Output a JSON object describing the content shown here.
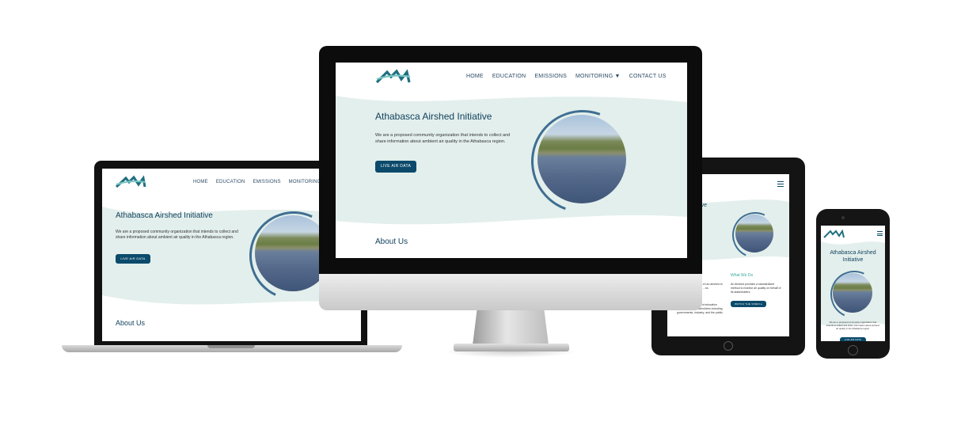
{
  "site": {
    "title": "Athabasca Airshed Initiative",
    "intro": "We are a proposed community organization that intends to collect and share information about ambient air quality in the Athabasca region.",
    "cta": "LIVE AIR DATA",
    "about": "About Us",
    "logo_text": "AAI"
  },
  "nav": {
    "home": "HOME",
    "education": "EDUCATION",
    "emissions": "EMISSIONS",
    "monitoring": "MONITORING ▼",
    "contact": "CONTACT US"
  },
  "tablet": {
    "what_we_do": "What We Do",
    "col_left": "...hed Initiative is a ...ch an airshed to ...quality and identify ...ns.",
    "col_left2": "...de credible data and education outreach to all stakeholders including governments, industry, and the public.",
    "col_right": "An Airshed provides a standardized method to monitor air quality on behalf of its stakeholders.",
    "video_btn": "WATCH THE VIDEO ▸"
  },
  "colors": {
    "primary": "#0b4a6b",
    "wave": "#e3efec",
    "heading": "#0f3f5c"
  },
  "icons": [
    "logo-icon",
    "hamburger-menu-icon",
    "dropdown-caret-icon"
  ]
}
